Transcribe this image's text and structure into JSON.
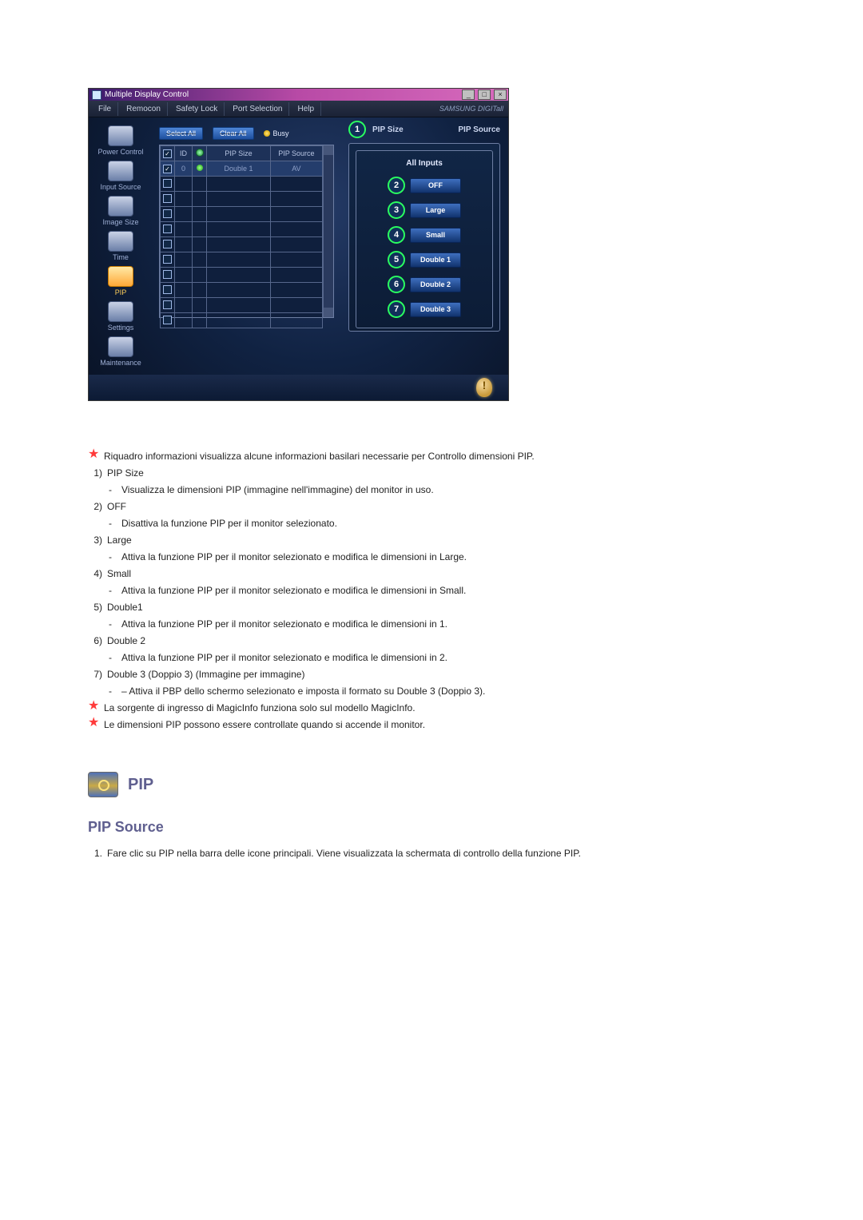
{
  "app": {
    "title": "Multiple Display Control",
    "brand": "SAMSUNG DIGITall",
    "menus": [
      "File",
      "Remocon",
      "Safety Lock",
      "Port Selection",
      "Help"
    ],
    "sidebar": [
      {
        "label": "Power Control"
      },
      {
        "label": "Input Source"
      },
      {
        "label": "Image Size"
      },
      {
        "label": "Time"
      },
      {
        "label": "PIP",
        "active": true
      },
      {
        "label": "Settings"
      },
      {
        "label": "Maintenance"
      }
    ],
    "toolbar": {
      "select_all": "Select All",
      "clear_all": "Clear All",
      "busy": "Busy"
    },
    "table": {
      "headers": {
        "chk": "",
        "id": "ID",
        "led": "",
        "pip_size": "PIP Size",
        "pip_source": "PIP Source"
      },
      "rows": [
        {
          "checked": true,
          "id": "0",
          "led": "green",
          "pip_size": "Double 1",
          "pip_source": "AV"
        },
        {},
        {},
        {},
        {},
        {},
        {},
        {},
        {},
        {},
        {}
      ]
    },
    "right": {
      "header_left": "PIP Size",
      "header_right": "PIP Source",
      "callout_header": "1",
      "box_title": "All Inputs",
      "options": [
        {
          "num": "2",
          "label": "OFF"
        },
        {
          "num": "3",
          "label": "Large"
        },
        {
          "num": "4",
          "label": "Small"
        },
        {
          "num": "5",
          "label": "Double 1"
        },
        {
          "num": "6",
          "label": "Double 2"
        },
        {
          "num": "7",
          "label": "Double 3"
        }
      ]
    },
    "sys_buttons": {
      "min": "_",
      "max": "□",
      "close": "×"
    }
  },
  "notes": {
    "star1": "Riquadro informazioni visualizza alcune informazioni basilari necessarie per Controllo dimensioni PIP.",
    "items": [
      {
        "num": "1)",
        "title": "PIP Size",
        "desc": "Visualizza le dimensioni PIP (immagine nell'immagine) del monitor in uso."
      },
      {
        "num": "2)",
        "title": "OFF",
        "desc": "Disattiva la funzione PIP per il monitor selezionato."
      },
      {
        "num": "3)",
        "title": "Large",
        "desc": "Attiva la funzione PIP per il monitor selezionato e modifica le dimensioni in Large."
      },
      {
        "num": "4)",
        "title": "Small",
        "desc": "Attiva la funzione PIP per il monitor selezionato e modifica le dimensioni in Small."
      },
      {
        "num": "5)",
        "title": "Double1",
        "desc": "Attiva la funzione PIP per il monitor selezionato e modifica le dimensioni in 1."
      },
      {
        "num": "6)",
        "title": "Double 2",
        "desc": "Attiva la funzione PIP per il monitor selezionato e modifica le dimensioni in 2."
      },
      {
        "num": "7)",
        "title": "Double 3 (Doppio 3) (Immagine per immagine)",
        "desc": "– Attiva il PBP dello schermo selezionato e imposta il formato su Double 3 (Doppio 3)."
      }
    ],
    "star2": "La sorgente di ingresso di MagicInfo funziona solo sul modello MagicInfo.",
    "star3": "Le dimensioni PIP possono essere controllate quando si accende il monitor."
  },
  "section": {
    "icon_label": "PIP",
    "subtitle": "PIP Source",
    "steps": [
      {
        "idx": "1.",
        "text": "Fare clic su PIP nella barra delle icone principali. Viene visualizzata la schermata di controllo della funzione PIP."
      }
    ]
  }
}
